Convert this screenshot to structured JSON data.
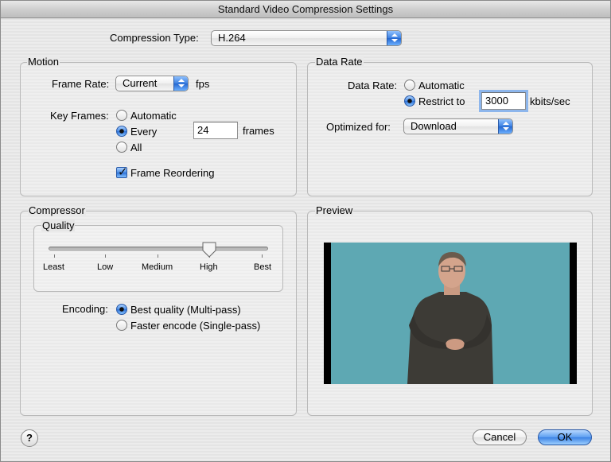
{
  "window": {
    "title": "Standard Video Compression Settings"
  },
  "compression": {
    "label": "Compression Type:",
    "value": "H.264"
  },
  "motion": {
    "title": "Motion",
    "frame_rate_label": "Frame Rate:",
    "frame_rate_value": "Current",
    "fps_label": "fps",
    "key_frames_label": "Key Frames:",
    "kf_automatic": "Automatic",
    "kf_every": "Every",
    "kf_every_value": "24",
    "frames_label": "frames",
    "kf_all": "All",
    "frame_reordering": "Frame Reordering",
    "frame_reordering_checked": true,
    "key_frames_selected": "Every"
  },
  "data_rate": {
    "title": "Data Rate",
    "label": "Data Rate:",
    "automatic": "Automatic",
    "restrict": "Restrict to",
    "restrict_value": "3000",
    "unit": "kbits/sec",
    "selected": "Restrict to",
    "optimized_label": "Optimized for:",
    "optimized_value": "Download"
  },
  "compressor": {
    "title": "Compressor",
    "quality_title": "Quality",
    "ticks": [
      "Least",
      "Low",
      "Medium",
      "High",
      "Best"
    ],
    "quality_level": 0.75,
    "encoding_label": "Encoding:",
    "best_quality": "Best quality (Multi-pass)",
    "faster_encode": "Faster encode (Single-pass)",
    "encoding_selected": "Best quality (Multi-pass)"
  },
  "preview": {
    "title": "Preview"
  },
  "buttons": {
    "help": "?",
    "cancel": "Cancel",
    "ok": "OK"
  },
  "colors": {
    "accent": "#3d82e4",
    "preview_background": "#5ea8b3"
  }
}
